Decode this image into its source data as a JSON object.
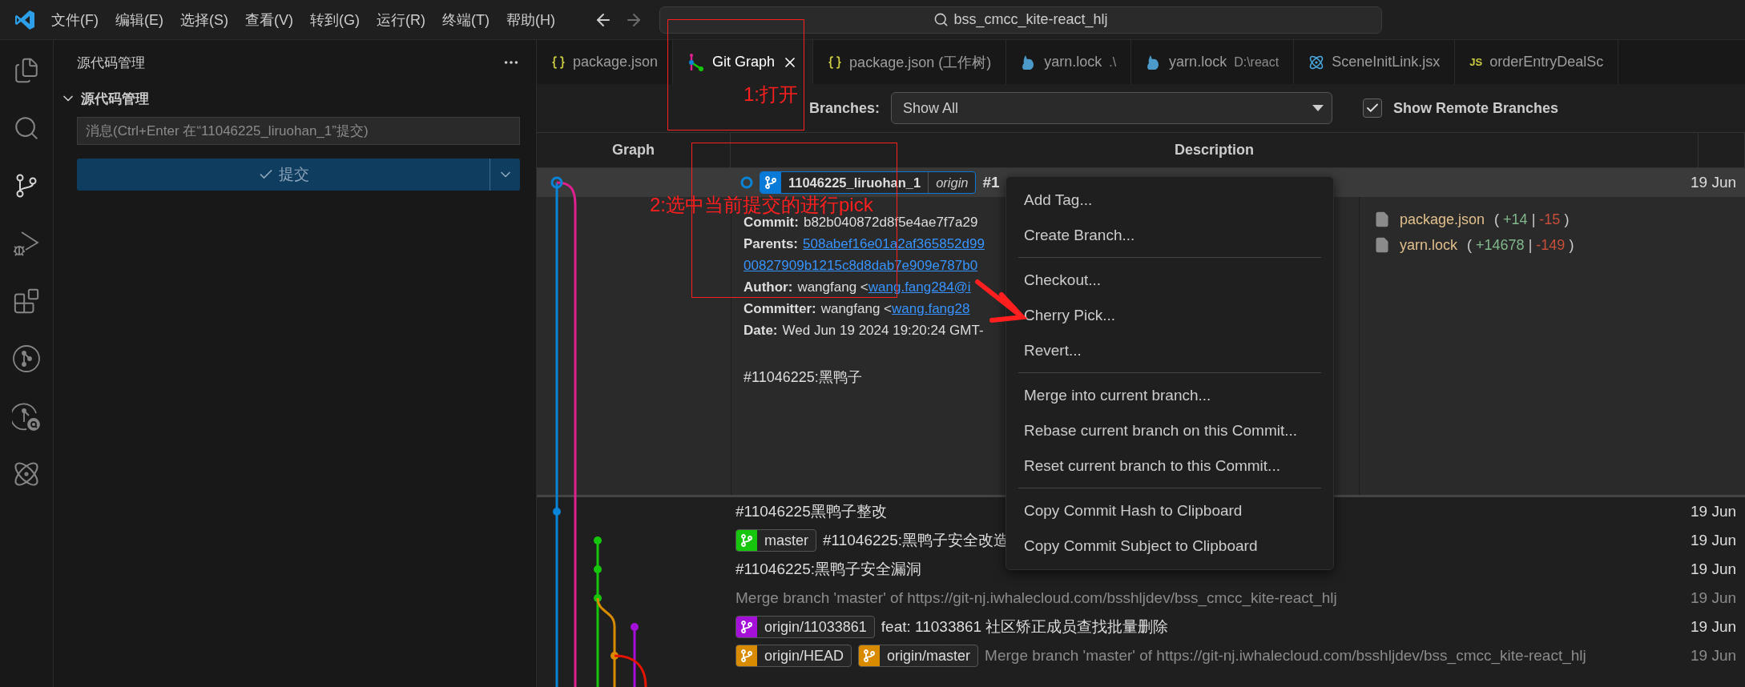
{
  "title_bar": {
    "menus": [
      "文件(F)",
      "编辑(E)",
      "选择(S)",
      "查看(V)",
      "转到(G)",
      "运行(R)",
      "终端(T)",
      "帮助(H)"
    ],
    "search": "bss_cmcc_kite-react_hlj"
  },
  "activity_bar": [
    {
      "kind": "files",
      "selected": false
    },
    {
      "kind": "search",
      "selected": false
    },
    {
      "kind": "source-control",
      "selected": true
    },
    {
      "kind": "run-debug",
      "selected": false
    },
    {
      "kind": "extensions",
      "selected": false
    },
    {
      "kind": "git-graph",
      "selected": false
    },
    {
      "kind": "git-graph-search",
      "selected": false
    },
    {
      "kind": "atom",
      "selected": false
    }
  ],
  "sidebar": {
    "title": "源代码管理",
    "section": {
      "title": "源代码管理",
      "expanded": true
    },
    "message_placeholder": "消息(Ctrl+Enter 在“11046225_liruohan_1”提交)",
    "commit_button": "提交"
  },
  "tabs": [
    {
      "label": "package.json",
      "kind": "json",
      "selected": false
    },
    {
      "label": "Git Graph",
      "kind": "git-graph",
      "selected": true
    },
    {
      "label": "package.json (工作树)",
      "kind": "json",
      "selected": false
    },
    {
      "label": "yarn.lock",
      "detail": ".\\",
      "kind": "yarn",
      "selected": false
    },
    {
      "label": "yarn.lock",
      "detail": "D:\\react",
      "kind": "yarn",
      "selected": false
    },
    {
      "label": "SceneInitLink.jsx",
      "kind": "react",
      "selected": false
    },
    {
      "label": "orderEntryDealSc",
      "kind": "js",
      "icon_text": "JS",
      "selected": false
    }
  ],
  "controls": {
    "branches_label": "Branches:",
    "branches_value": "Show All",
    "show_remote": {
      "label": "Show Remote Branches",
      "checked": true
    }
  },
  "table": {
    "columns": [
      "Graph",
      "Description"
    ],
    "selected_commit": {
      "refs": [
        {
          "name": "11046225_liruohan_1",
          "remote": "origin",
          "color": "#0a7ad8"
        }
      ],
      "message": "#1",
      "date": "19 Jun",
      "details": [
        {
          "label": "Commit:",
          "text": "b82b040872d8f5e4ae7f7a29"
        },
        {
          "label": "Parents:",
          "link": "508abef16e01a2af365852d99"
        },
        {
          "link": "00827909b1215c8d8dab7e909e787b0"
        },
        {
          "label": "Author:",
          "text": "wangfang <",
          "link": "wang.fang284@i"
        },
        {
          "label": "Committer:",
          "text": "wangfang <",
          "link": "wang.fang28"
        },
        {
          "label": "Date:",
          "text": "Wed Jun 19 2024 19:20:24 GMT-"
        }
      ],
      "body": "#11046225:黑鸭子",
      "files": [
        {
          "name": "package.json",
          "open": "(",
          "added": "+14",
          "separator": "|",
          "removed": "-15",
          "close": ")"
        },
        {
          "name": "yarn.lock",
          "open": "(",
          "added": "+14678",
          "separator": "|",
          "removed": "-149",
          "close": ")"
        }
      ]
    },
    "rows": [
      {
        "refs": [],
        "message": "#11046225黑鸭子整改",
        "date": "19 Jun",
        "muted": false
      },
      {
        "refs": [
          {
            "name": "master",
            "color": "#16c60c"
          }
        ],
        "message": "#11046225:黑鸭子安全改造",
        "date": "19 Jun",
        "muted": false
      },
      {
        "refs": [],
        "message": "#11046225:黑鸭子安全漏洞",
        "date": "19 Jun",
        "muted": false
      },
      {
        "refs": [],
        "message": "Merge branch 'master' of https://git-nj.iwhalecloud.com/bsshljdev/bss_cmcc_kite-react_hlj",
        "date": "19 Jun",
        "muted": true
      },
      {
        "refs": [
          {
            "name": "origin/11033861",
            "color": "#a410d8"
          }
        ],
        "message": "feat: 11033861 社区矫正成员查找批量删除",
        "date": "19 Jun",
        "muted": false
      },
      {
        "refs": [
          {
            "name": "origin/HEAD",
            "color": "#d98b00"
          },
          {
            "name": "origin/master",
            "color": "#d98b00"
          }
        ],
        "message": "Merge branch 'master' of https://git-nj.iwhalecloud.com/bsshljdev/bss_cmcc_kite-react_hlj",
        "date": "19 Jun",
        "muted": true
      }
    ]
  },
  "context_menu": [
    {
      "kind": "item",
      "label": "Add Tag..."
    },
    {
      "kind": "item",
      "label": "Create Branch..."
    },
    {
      "kind": "separator"
    },
    {
      "kind": "item",
      "label": "Checkout..."
    },
    {
      "kind": "item",
      "label": "Cherry Pick..."
    },
    {
      "kind": "item",
      "label": "Revert..."
    },
    {
      "kind": "separator"
    },
    {
      "kind": "item",
      "label": "Merge into current branch..."
    },
    {
      "kind": "item",
      "label": "Rebase current branch on this Commit..."
    },
    {
      "kind": "item",
      "label": "Reset current branch to this Commit..."
    },
    {
      "kind": "separator"
    },
    {
      "kind": "item",
      "label": "Copy Commit Hash to Clipboard"
    },
    {
      "kind": "item",
      "label": "Copy Commit Subject to Clipboard"
    }
  ],
  "annotations": [
    "1:打开",
    "2:选中当前提交的进行pick"
  ]
}
